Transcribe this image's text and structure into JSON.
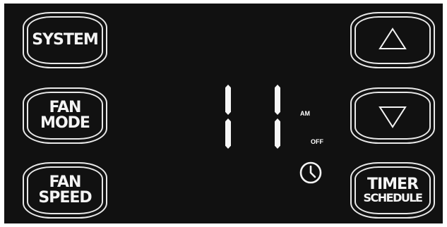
{
  "buttons": {
    "system": {
      "lines": [
        "SYSTEM"
      ]
    },
    "fan_mode": {
      "lines": [
        "FAN",
        "MODE"
      ]
    },
    "fan_speed": {
      "lines": [
        "FAN",
        "SPEED"
      ]
    },
    "up": {
      "icon": "up-triangle-icon"
    },
    "down": {
      "icon": "down-triangle-icon"
    },
    "timer_schedule": {
      "lines": [
        "TIMER",
        "SCHEDULE"
      ]
    }
  },
  "display": {
    "time_digits": "11",
    "am_label": "AM",
    "off_label": "OFF",
    "clock_icon": "clock-icon"
  },
  "colors": {
    "panel": "#111111",
    "foreground": "#f4f4f4"
  }
}
